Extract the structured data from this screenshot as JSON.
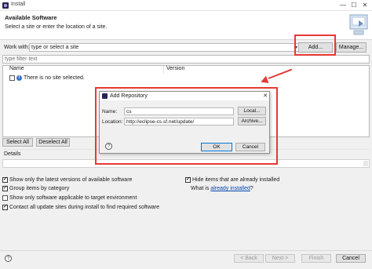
{
  "window": {
    "title": "Install"
  },
  "header": {
    "title": "Available Software",
    "subtitle": "Select a site or enter the location of a site."
  },
  "work_with": {
    "label": "Work with:",
    "placeholder": "type or select a site",
    "add_label": "Add...",
    "manage_label": "Manage..."
  },
  "filter": {
    "placeholder": "type filter text"
  },
  "table": {
    "columns": [
      "Name",
      "Version"
    ],
    "rows": [
      {
        "name": "There is no site selected.",
        "version": ""
      }
    ]
  },
  "buttons": {
    "select_all": "Select All",
    "deselect_all": "Deselect All"
  },
  "details": {
    "label": "Details"
  },
  "options": {
    "latest_versions": {
      "label": "Show only the latest versions of available software",
      "checked": true
    },
    "group_by_category": {
      "label": "Group items by category",
      "checked": true
    },
    "target_env": {
      "label": "Show only software applicable to target environment",
      "checked": false
    },
    "contact_sites": {
      "label": "Contact all update sites during install to find required software",
      "checked": true
    },
    "hide_installed": {
      "label": "Hide items that are already installed",
      "checked": true
    },
    "what_is": {
      "prefix": "What is",
      "link": "already installed",
      "suffix": "?"
    }
  },
  "footer": {
    "back": "< Back",
    "next": "Next >",
    "finish": "Finish",
    "cancel": "Cancel"
  },
  "dialog": {
    "title": "Add Repository",
    "name_label": "Name:",
    "name_value": "cs",
    "local_label": "Local...",
    "location_label": "Location:",
    "location_value": "http://eclipse-cs.sf.net/update/",
    "archive_label": "Archive...",
    "ok_label": "OK",
    "cancel_label": "Cancel"
  },
  "colors": {
    "annotation": "#e53935",
    "accent": "#0078d7",
    "link": "#0645ad"
  }
}
